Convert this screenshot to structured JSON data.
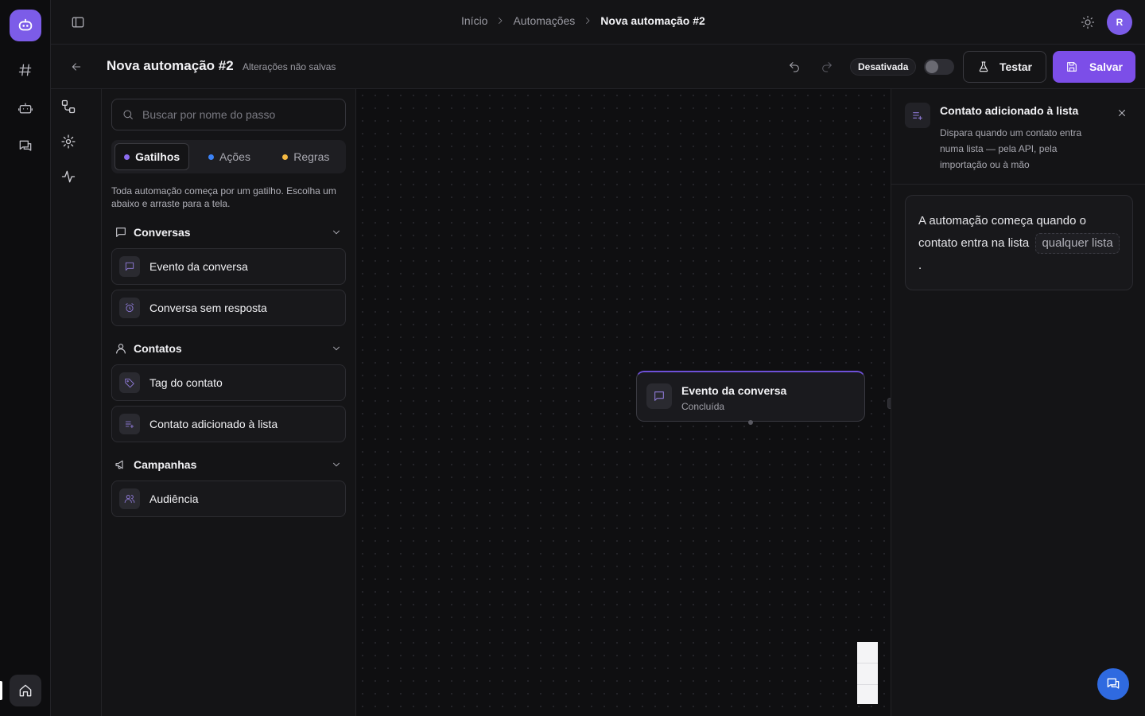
{
  "breadcrumb": {
    "items": [
      "Início",
      "Automações"
    ],
    "current": "Nova automação #2"
  },
  "user": {
    "avatar_initial": "R"
  },
  "editor": {
    "title": "Nova automação #2",
    "save_status": "Alterações não salvas",
    "status_label": "Desativada",
    "test_label": "Testar",
    "save_label": "Salvar"
  },
  "palette": {
    "search_placeholder": "Buscar por nome do passo",
    "tabs": [
      {
        "label": "Gatilhos",
        "dot_color": "#8b6cf0"
      },
      {
        "label": "Ações",
        "dot_color": "#3b82f6"
      },
      {
        "label": "Regras",
        "dot_color": "#f5b942"
      }
    ],
    "hint": "Toda automação começa por um gatilho. Escolha um abaixo e arraste para a tela.",
    "groups": [
      {
        "label": "Conversas",
        "items": [
          "Evento da conversa",
          "Conversa sem resposta"
        ]
      },
      {
        "label": "Contatos",
        "items": [
          "Tag do contato",
          "Contato adicionado à lista"
        ]
      },
      {
        "label": "Campanhas",
        "items": [
          "Audiência"
        ]
      }
    ]
  },
  "canvas": {
    "node": {
      "title": "Evento da conversa",
      "subtitle": "Concluída"
    }
  },
  "details": {
    "title": "Contato adicionado à lista",
    "description": "Dispara quando um contato entra numa lista — pela API, pela importação ou à mão",
    "sentence": "A automação começa quando o contato entra na lista",
    "chip": "qualquer lista",
    "sentence_end": "."
  },
  "colors": {
    "accent": "#7c4ee8",
    "chat_button": "#2f6ae0"
  }
}
